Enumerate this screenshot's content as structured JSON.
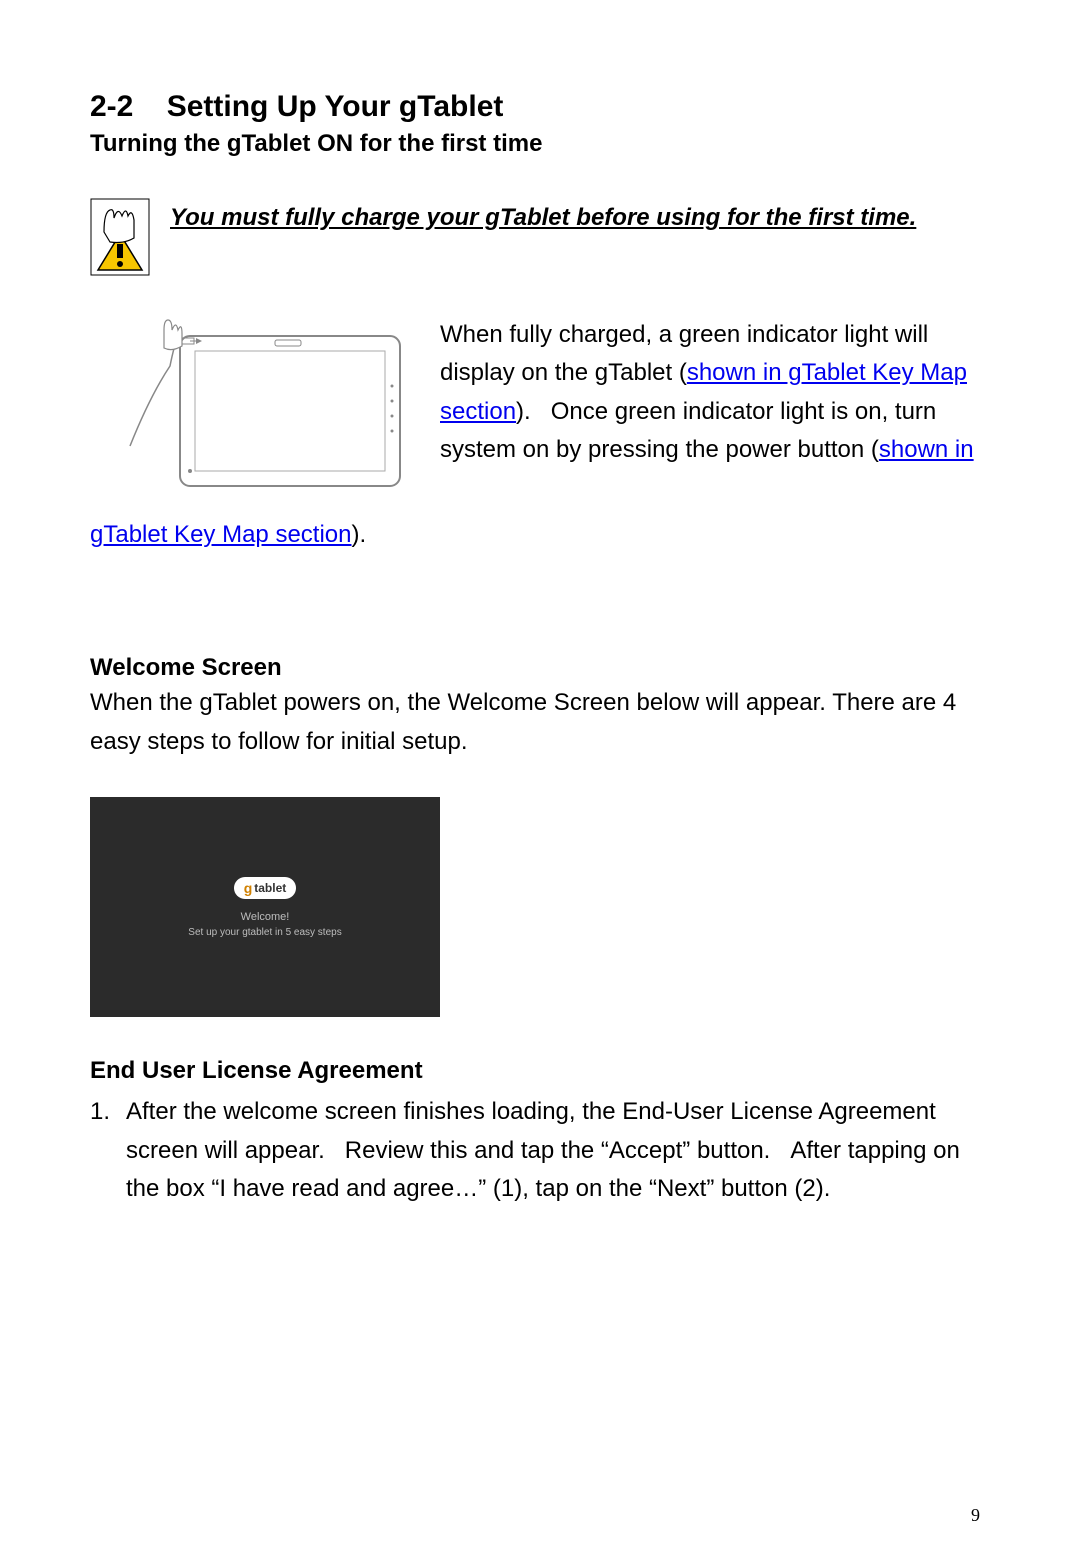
{
  "section": {
    "number": "2-2",
    "title": "Setting Up Your gTablet",
    "subtitle": "Turning the gTablet ON for the first time"
  },
  "notice": {
    "text": "You must fully charge your gTablet before using for the first time."
  },
  "charging": {
    "part1": "When fully charged, a green indicator light will display on the gTablet (",
    "link1": "shown in gTablet Key Map section",
    "part2": ").   Once green indicator light is on, turn system on by pressing the power button (",
    "link2": "shown in ",
    "cont_link": "gTablet Key Map section",
    "cont_after": ")."
  },
  "welcome": {
    "heading": "Welcome Screen",
    "body": "When the gTablet powers on, the Welcome Screen below will appear. There are 4 easy steps to follow for initial setup.",
    "screenshot": {
      "logo_g": "g",
      "logo_tablet": "tablet",
      "welcome_label": "Welcome!",
      "welcome_sub": "Set up your gtablet in 5 easy steps"
    }
  },
  "eula": {
    "heading": "End User License Agreement",
    "item_number": "1.",
    "item_text": "After the welcome screen finishes loading, the End-User License Agreement screen will appear.   Review this and tap the “Accept” button.   After tapping on the box “I have read and agree…” (1), tap on the “Next” button (2)."
  },
  "page_number": "9"
}
